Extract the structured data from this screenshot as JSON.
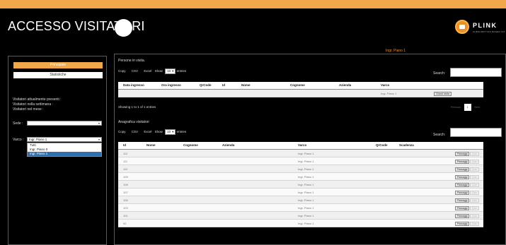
{
  "header": {
    "title": "ACCESSO VISITATORI",
    "logo_text": "PLINK",
    "logo_subtext": "SUBSCRIPTION BASED IOT",
    "location": "Ingr. Piano 1"
  },
  "sidebar": {
    "principale_label": "Principale",
    "statistiche_label": "Statistiche",
    "stats": [
      "Visitatori attualmente presenti :",
      "Visitatori nella settimana :",
      "Visitatori nel mese :"
    ],
    "sede_label": "Sede :",
    "sede_value": "",
    "varco_label": "Varco :",
    "varco_value": "Ingr. Piano 1",
    "varco_options": [
      "Tutti",
      "Ingr. Piano 0",
      "Ingr. Piano 1"
    ],
    "varco_selected": "Ingr. Piano 1"
  },
  "persone": {
    "title": "Persone in visita.",
    "toolbar": {
      "copy": "Copy",
      "csv": "CSV",
      "excel": "Excel",
      "show": "Show",
      "entries_value": "10",
      "entries": "entries"
    },
    "search_label": "Search:",
    "columns": [
      "Data ingresso",
      "Ora ingresso",
      "QrCode",
      "Id",
      "Nome",
      "Cognome",
      "Azienda",
      "Varco"
    ],
    "rows": [
      {
        "varco": "Ingr. Piano 1",
        "action": "Chiudi visita"
      }
    ],
    "info": "Showing 1 to 1 of 1 entries",
    "pager": {
      "previous": "Previous",
      "page": "1",
      "next": "Next"
    }
  },
  "anagrafica": {
    "title": "Anagrafica visitatori",
    "toolbar": {
      "copy": "Copy",
      "csv": "CSV",
      "excel": "Excel",
      "show": "Show",
      "entries_value": "10",
      "entries": "entries"
    },
    "search_label": "Search:",
    "columns": [
      "Id",
      "Nome",
      "Cognome",
      "Azienda",
      "Varco",
      "QrCode",
      "Scadenza"
    ],
    "action_pass": "Passaggi",
    "action_other": "Qua",
    "rows": [
      {
        "id": "112",
        "varco": "Ingr. Piano 1"
      },
      {
        "id": "111",
        "varco": "Ingr. Piano 1"
      },
      {
        "id": "110",
        "varco": "Ingr. Piano 1"
      },
      {
        "id": "109",
        "varco": "Ingr. Piano 1"
      },
      {
        "id": "108",
        "varco": "Ingr. Piano 1"
      },
      {
        "id": "107",
        "varco": "Ingr. Piano 1"
      },
      {
        "id": "106",
        "varco": "Ingr. Piano 1"
      },
      {
        "id": "103",
        "varco": "Ingr. Piano 1"
      },
      {
        "id": "101",
        "varco": "Ingr. Piano 1"
      },
      {
        "id": "92",
        "varco": "Ingr. Piano 1"
      }
    ]
  }
}
